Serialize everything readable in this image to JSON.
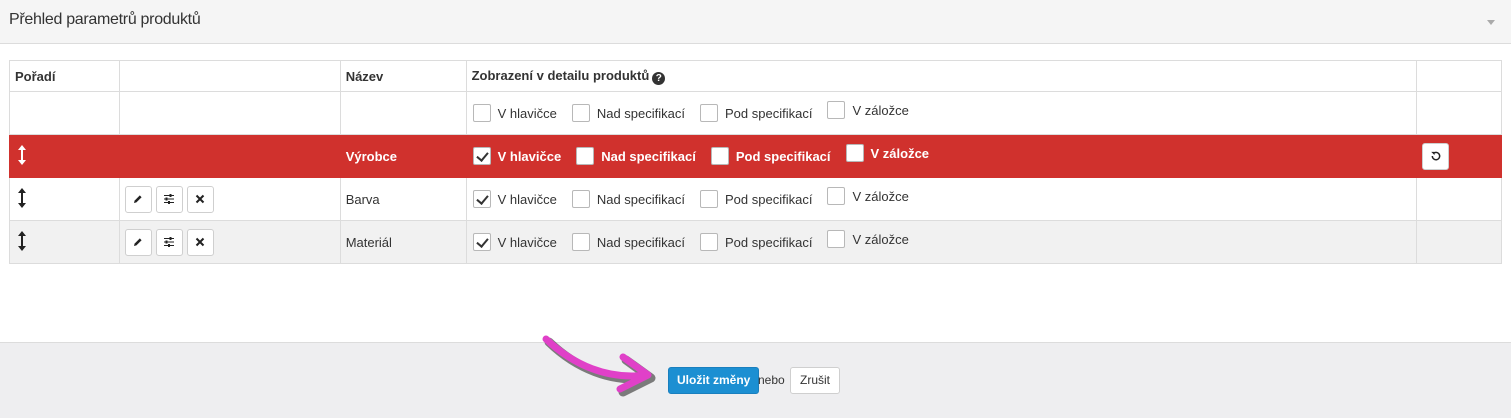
{
  "panel": {
    "title": "Přehled parametrů produktů"
  },
  "table": {
    "headers": {
      "order": "Pořadí",
      "actions": "",
      "name": "Název",
      "display": "Zobrazení v detailu produktů",
      "extra": ""
    },
    "options": [
      "V hlavičce",
      "Nad specifikací",
      "Pod specifikací",
      "V záložce"
    ],
    "filter_row": {
      "checked": [
        false,
        false,
        false,
        false
      ]
    },
    "rows": [
      {
        "name": "Výrobce",
        "checked": [
          true,
          false,
          false,
          false
        ],
        "highlighted": true
      },
      {
        "name": "Barva",
        "checked": [
          true,
          false,
          false,
          false
        ],
        "highlighted": false
      },
      {
        "name": "Materiál",
        "checked": [
          true,
          false,
          false,
          false
        ],
        "highlighted": false
      }
    ]
  },
  "footer": {
    "save_label": "Uložit změny",
    "or_text": "nebo",
    "cancel_label": "Zrušit"
  },
  "colors": {
    "highlight_row": "#d0312d",
    "primary_button": "#1c8fd2",
    "annotation_arrow": "#e040c8"
  },
  "icons": {
    "drag": "vertical-resize-arrow-icon",
    "edit": "pencil-icon",
    "settings": "sliders-icon",
    "delete": "close-x-icon",
    "restore": "undo-icon",
    "help": "question-circle-icon",
    "collapse": "caret-down-icon"
  }
}
